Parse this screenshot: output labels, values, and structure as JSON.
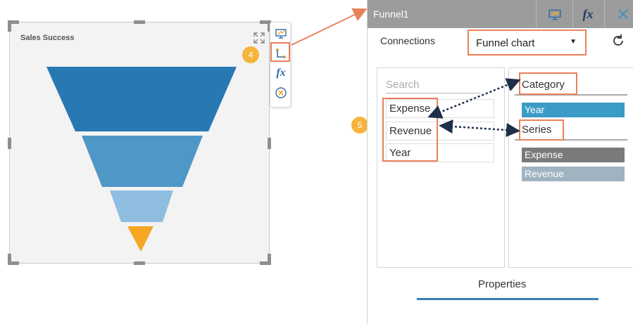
{
  "widget": {
    "title": "Sales Success",
    "funnel_colors": [
      "#2878b4",
      "#4f97c7",
      "#8fbde0",
      "#f5a623"
    ]
  },
  "toolbar": {
    "icons": [
      "preview-icon",
      "data-config-icon",
      "formula-icon",
      "remove-icon"
    ],
    "formula_label": "fx"
  },
  "badges": {
    "step4": "4",
    "step5": "5",
    "color": "#f5b43b"
  },
  "panel": {
    "title": "Funnel1",
    "formula_label": "fx",
    "connections_label": "Connections",
    "chart_type": "Funnel chart",
    "search_placeholder": "Search",
    "fields": [
      "Expense",
      "Revenue",
      "Year"
    ],
    "category_label": "Category",
    "category_items": [
      "Year"
    ],
    "series_label": "Series",
    "series_items": [
      "Expense",
      "Revenue"
    ],
    "properties_tab": "Properties"
  },
  "colors": {
    "highlight": "#e8825a",
    "header_bg": "#9c9c9c",
    "category_chip": "#3a9cc6",
    "series_chip_1": "#7a7a7a",
    "series_chip_2": "#9fb3c0"
  }
}
